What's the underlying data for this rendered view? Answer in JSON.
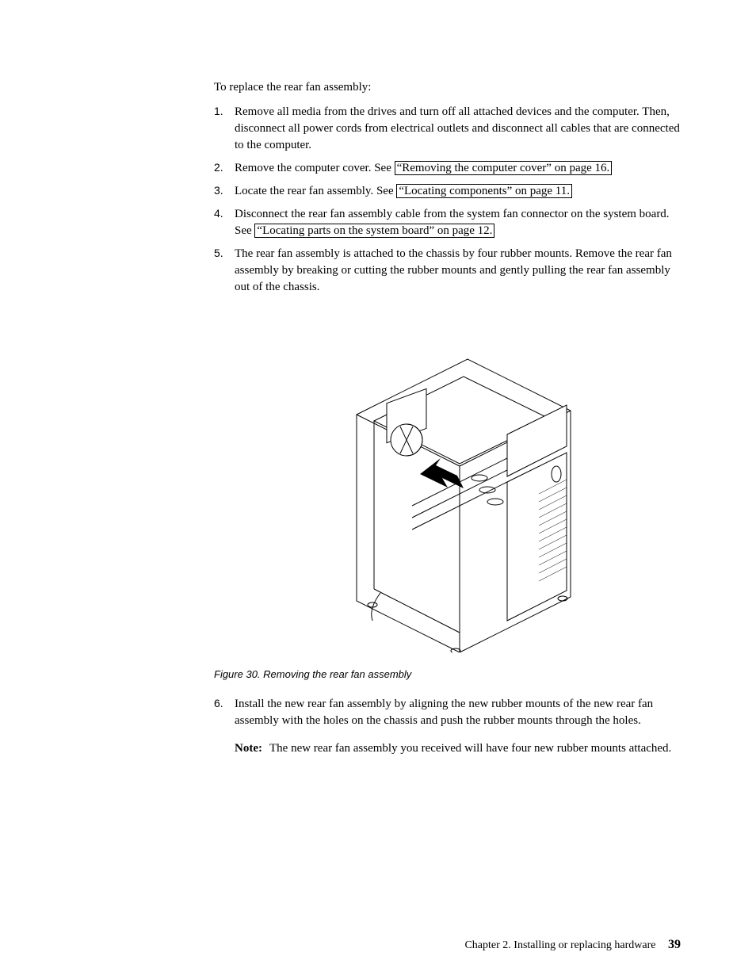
{
  "intro": "To replace the rear fan assembly:",
  "steps": [
    {
      "num": "1.",
      "segments": [
        {
          "text": "Remove all media from the drives and turn off all attached devices and the computer. Then, disconnect all power cords from electrical outlets and disconnect all cables that are connected to the computer."
        }
      ]
    },
    {
      "num": "2.",
      "segments": [
        {
          "text": "Remove the computer cover. See "
        },
        {
          "text": "“Removing the computer cover” on page 16.",
          "xref": true
        }
      ]
    },
    {
      "num": "3.",
      "segments": [
        {
          "text": "Locate the rear fan assembly. See "
        },
        {
          "text": "“Locating components” on page 11.",
          "xref": true
        }
      ]
    },
    {
      "num": "4.",
      "segments": [
        {
          "text": "Disconnect the rear fan assembly cable from the system fan connector on the system board. See "
        },
        {
          "text": "“Locating parts on the system board” on page 12.",
          "xref": true
        }
      ]
    },
    {
      "num": "5.",
      "segments": [
        {
          "text": "The rear fan assembly is attached to the chassis by four rubber mounts. Remove the rear fan assembly by breaking or cutting the rubber mounts and gently pulling the rear fan assembly out of the chassis."
        }
      ]
    }
  ],
  "figure_caption": "Figure 30. Removing the rear fan assembly",
  "step6": {
    "num": "6.",
    "text": "Install the new rear fan assembly by aligning the new rubber mounts of the new rear fan assembly with the holes on the chassis and push the rubber mounts through the holes.",
    "note_label": "Note:",
    "note_text": "The new rear fan assembly you received will have four new rubber mounts attached."
  },
  "footer": {
    "chapter": "Chapter 2. Installing or replacing hardware",
    "page": "39"
  }
}
